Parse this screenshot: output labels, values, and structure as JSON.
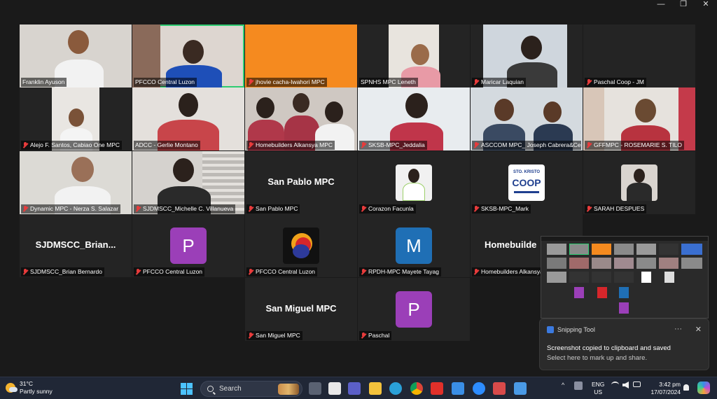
{
  "window_controls": {
    "minimize": "—",
    "restore": "❐",
    "close": "✕"
  },
  "participants": [
    {
      "label": "Franklin Ayuson"
    },
    {
      "label": "PFCCO Central Luzon"
    },
    {
      "label": "jhovie cacha-Iwahori MPC"
    },
    {
      "label": "SPNHS MPC Leneth"
    },
    {
      "label": "Maricar Laquian"
    },
    {
      "label": "Paschal Coop - JM"
    },
    {
      "label": "Alejo F. Santos, Cabiao One MPC"
    },
    {
      "label": "ADCC - Gerlie Montano"
    },
    {
      "label": "Homebuilders Alkansya MPC"
    },
    {
      "label": "SKSB-MPC_Jeddalia"
    },
    {
      "label": "ASCCOM MPC_ Joseph Cabrera&Ce..."
    },
    {
      "label": "GFFMPC - ROSEMARIE S. TILO"
    },
    {
      "label": "Dynamic MPC - Nerza S. Salazar"
    },
    {
      "label": "SJDMSCC_Michelle C. Villanueva"
    },
    {
      "label": "San Pablo MPC",
      "display": "San Pablo MPC"
    },
    {
      "label": "Corazon Facunla"
    },
    {
      "label": "SKSB-MPC_Mark",
      "logo_text": "STO. KRISTO",
      "logo_word": "COOP"
    },
    {
      "label": "SARAH DESPUES"
    },
    {
      "label": "SJDMSCC_Brian Bernardo",
      "display": "SJDMSCC_Brian..."
    },
    {
      "label": "PFCCO Central Luzon",
      "avatar_letter": "P",
      "avatar_color": "#9b3fb8"
    },
    {
      "label": "PFCCO Central Luzon"
    },
    {
      "label": "RPDH-MPC Mayete Tayag",
      "avatar_letter": "M",
      "avatar_color": "#1f6fb5"
    },
    {
      "label": "Homebuilders Alkansya MPC",
      "display": "Homebuilde"
    },
    {
      "label": "San Miguel MPC",
      "display": "San Miguel MPC"
    },
    {
      "label": "Paschal",
      "avatar_letter": "P",
      "avatar_color": "#9b3fb8"
    }
  ],
  "snip_toast": {
    "app": "Snipping Tool",
    "line1": "Screenshot copied to clipboard and saved",
    "line2": "Select here to mark up and share.",
    "more": "···",
    "close": "✕"
  },
  "taskbar": {
    "temperature": "31°C",
    "condition": "Partly sunny",
    "search_placeholder": "Search",
    "lang_top": "ENG",
    "lang_bottom": "US",
    "time": "3:42 pm",
    "date": "17/07/2024",
    "chevron": "^"
  }
}
